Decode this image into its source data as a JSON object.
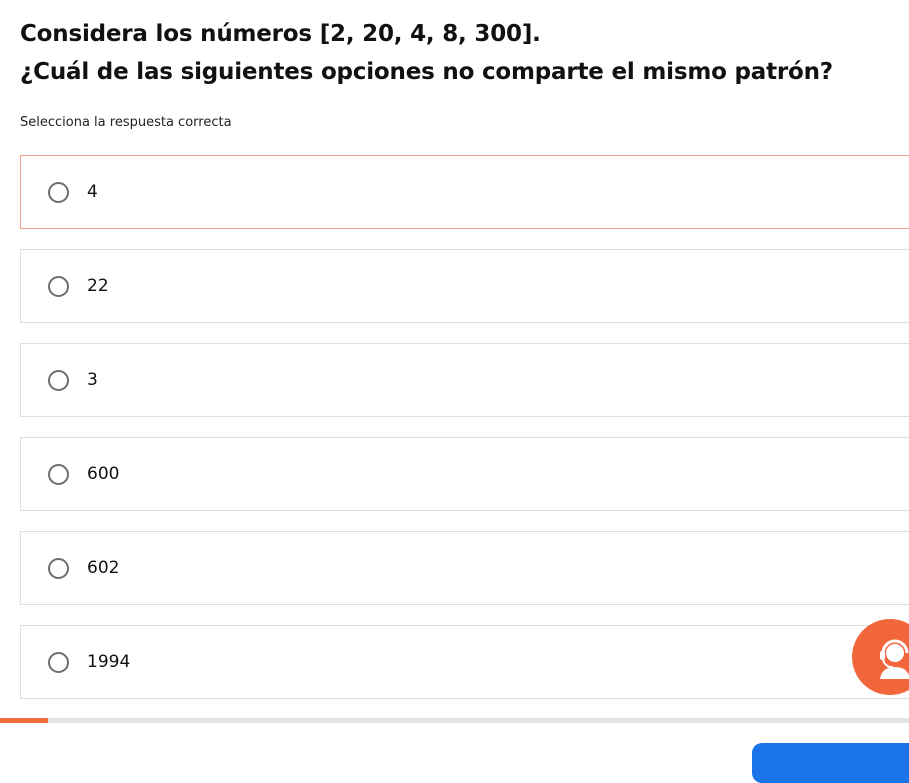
{
  "question": {
    "line1": "Considera los números [2, 20, 4, 8, 300].",
    "line2": "¿Cuál de las siguientes opciones no comparte el mismo patrón?",
    "instruction": "Selecciona la respuesta correcta"
  },
  "options": [
    {
      "label": "4",
      "state": "hover"
    },
    {
      "label": "22",
      "state": "default"
    },
    {
      "label": "3",
      "state": "default"
    },
    {
      "label": "600",
      "state": "default"
    },
    {
      "label": "602",
      "state": "default"
    },
    {
      "label": "1994",
      "state": "default"
    }
  ],
  "progress": {
    "fraction": 0.053
  },
  "support_button": {
    "icon": "support-agent-icon"
  },
  "colors": {
    "accent": "#f26b3a",
    "option_hover_border": "#f1a58a",
    "option_border": "#dedede",
    "primary_button": "#1a73e8"
  }
}
